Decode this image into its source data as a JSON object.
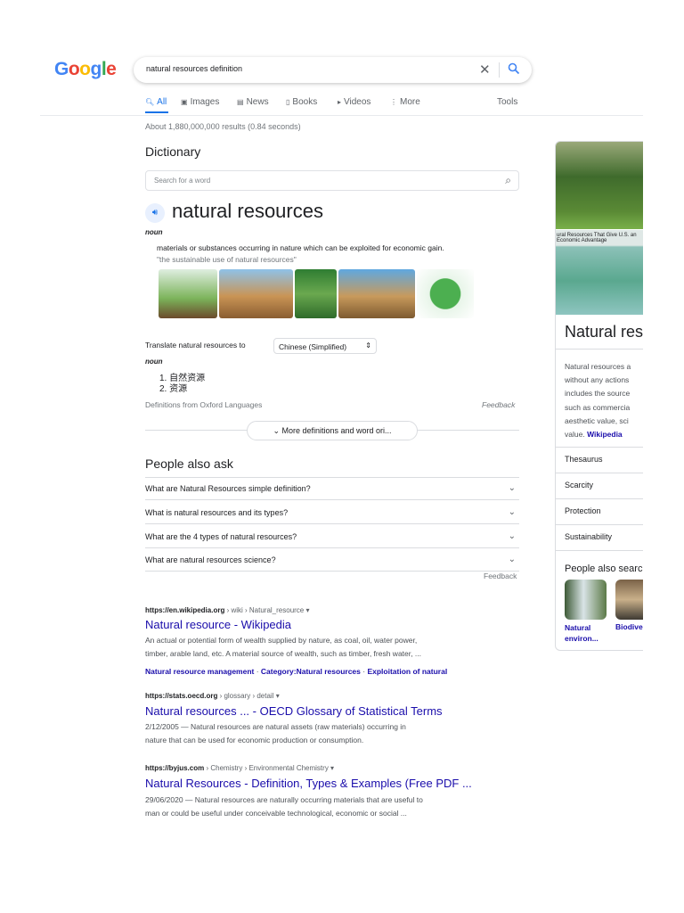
{
  "header": {
    "logo": "Google",
    "query": "natural resources definition"
  },
  "tabs": [
    {
      "label": "All",
      "icon": "search-icon",
      "active": true
    },
    {
      "label": "Images",
      "icon": "image-icon"
    },
    {
      "label": "News",
      "icon": "news-icon"
    },
    {
      "label": "Books",
      "icon": "book-icon"
    },
    {
      "label": "Videos",
      "icon": "video-icon"
    },
    {
      "label": "More",
      "icon": "more-vert-icon"
    }
  ],
  "tools": "Tools",
  "stats": "About 1,880,000,000 results (0.84 seconds)",
  "dictionary": {
    "heading": "Dictionary",
    "search_placeholder": "Search for a word",
    "word": "natural resources",
    "pos": "noun",
    "definition": "materials or substances occurring in nature which can be exploited for economic gain.",
    "example": "\"the sustainable use of natural resources\"",
    "translate_label": "Translate natural resources to",
    "language": "Chinese (Simplified)",
    "tr_pos": "noun",
    "translations": [
      "1. 自然资源",
      "2. 资源"
    ],
    "source": "Definitions from Oxford Languages",
    "feedback": "Feedback",
    "more": "More definitions and word ori..."
  },
  "paa": {
    "heading": "People also ask",
    "questions": [
      "What are Natural Resources simple definition?",
      "What is natural resources and its types?",
      "What are the 4 types of natural resources?",
      "What are natural resources science?"
    ],
    "feedback": "Feedback"
  },
  "results": [
    {
      "domain": "https://en.wikipedia.org",
      "path": " › wiki › Natural_resource",
      "title": "Natural resource - Wikipedia",
      "snippet": [
        "An actual or potential form of wealth supplied by nature, as coal, oil, water power,",
        "timber, arable land, etc. A material source of wealth, such as timber, fresh water, ..."
      ],
      "links": [
        "Natural resource management",
        "Category:Natural resources",
        "Exploitation of natural"
      ]
    },
    {
      "domain": "https://stats.oecd.org",
      "path": " › glossary › detail",
      "title": "Natural resources ... - OECD Glossary of Statistical Terms",
      "snippet": [
        "2/12/2005 — Natural resources are natural assets (raw materials) occurring in",
        "nature that can be used for economic production or consumption."
      ]
    },
    {
      "domain": "https://byjus.com",
      "path": " › Chemistry › Environmental Chemistry",
      "title": "Natural Resources - Definition, Types & Examples (Free PDF ...",
      "snippet": [
        "29/06/2020 — Natural resources are naturally occurring materials that are useful to",
        "man or could be useful under conceivable technological, economic or social ..."
      ]
    }
  ],
  "knowledge_panel": {
    "title": "Natural resources",
    "image_caption": "ural Resources That Give U.S. an Economic Advantage",
    "description": [
      "Natural resources a",
      "without any actions",
      "includes the source",
      "such as commercia",
      "aesthetic value, sci",
      "value."
    ],
    "wiki": "Wikipedia",
    "items": [
      "Thesaurus",
      "Scarcity",
      "Protection",
      "Sustainability"
    ],
    "also_search": "People also search for",
    "also": [
      {
        "label1": "Natural",
        "label2": "environ..."
      },
      {
        "label1": "Biodive",
        "label2": ""
      }
    ]
  }
}
